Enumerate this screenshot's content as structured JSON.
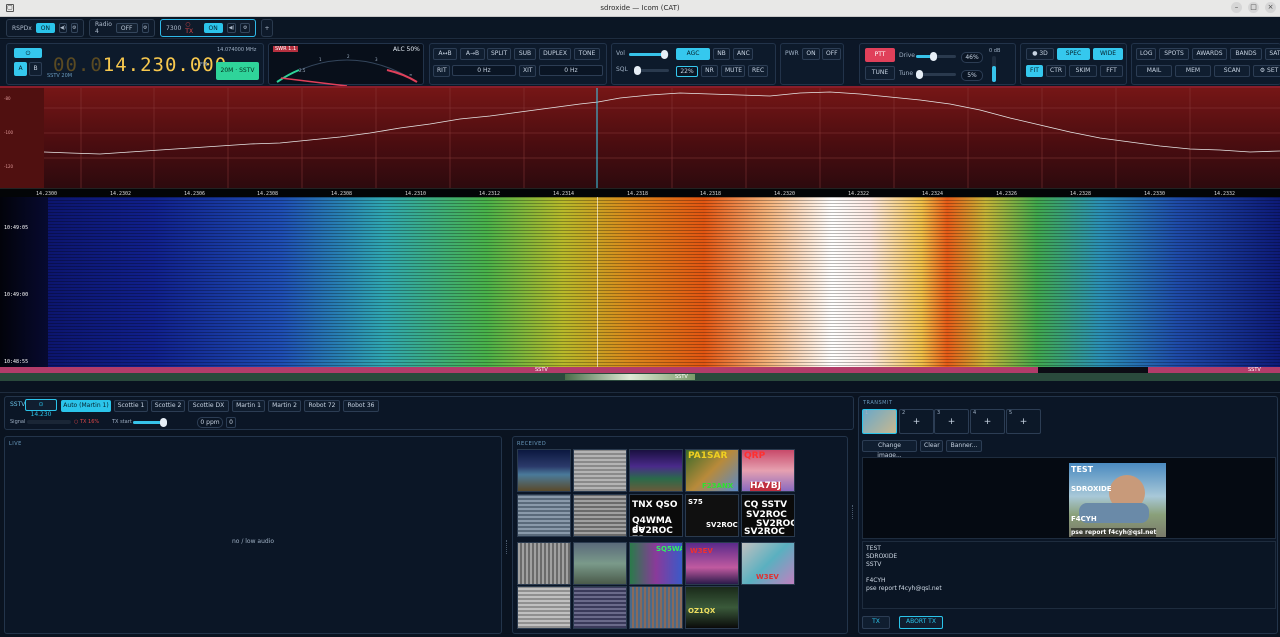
{
  "window": {
    "title": "sdroxide — Icom (CAT)"
  },
  "radio_tabs": [
    {
      "name": "RSPDx",
      "state": "ON"
    },
    {
      "name": "Radio 4",
      "state": "OFF"
    },
    {
      "name": "7300",
      "tx": "TX",
      "state": "ON"
    }
  ],
  "add_tab": "+",
  "vfo": {
    "power_icon": "power-icon",
    "a": "A",
    "b": "B",
    "freq_dim": "00.0",
    "freq_main": "14.230.000",
    "unit": "FM",
    "sub_freq": "14.074000 MHz",
    "mode_label": "SSTV 20M",
    "mode_button": "20M · SSTV"
  },
  "meter": {
    "swr": "SWR 1.1",
    "alc": "ALC 50%",
    "scale": [
      "1",
      "1.5",
      "2",
      "3",
      "∞"
    ],
    "low": "2.5"
  },
  "split_group": {
    "ab": "A↔B",
    "aeqb": "A→B",
    "split": "SPLIT",
    "sub": "SUB",
    "duplex": "DUPLEX",
    "tone": "TONE",
    "rit": "RIT",
    "rit_val": "0 Hz",
    "xit": "XIT",
    "xit_val": "0 Hz"
  },
  "audio_group": {
    "vol": "Vol",
    "sql": "SQL",
    "agc": "AGC Med",
    "nb": "NB",
    "anc": "ANC",
    "sql_val": "22%",
    "nr": "NR",
    "mute": "MUTE",
    "rec": "REC",
    "vol_level": 0.9,
    "sql_level": 0.1
  },
  "pwr_group": {
    "pwr": "PWR",
    "on": "ON",
    "off": "OFF"
  },
  "tx_group": {
    "ptt": "PTT",
    "tune": "TUNE",
    "drive": "Drive",
    "drive_val": "46%",
    "tune_lbl": "Tune",
    "tune_val": "5%",
    "db": "0 dB",
    "drive_level": 0.46,
    "tune_level": 0.05
  },
  "view_group": {
    "d3": "3D",
    "spec": "SPEC",
    "wide": "WIDE",
    "fit": "FIT",
    "ctr": "CTR",
    "skim": "SKIM",
    "fft": "FFT"
  },
  "tools_group": {
    "log": "LOG",
    "spots": "SPOTS",
    "awards": "AWARDS",
    "bands": "BANDS",
    "sat": "SAT",
    "mail": "MAIL",
    "mem": "MEM",
    "scan": "SCAN",
    "set": "SET"
  },
  "spectrum": {
    "db_labels": [
      "-80",
      "-100",
      "-120"
    ],
    "freq_labels": [
      "14.2300",
      "14.2302",
      "14.2306",
      "14.2308",
      "14.2308",
      "14.2310",
      "14.2312",
      "14.2314",
      "14.2318",
      "14.2318",
      "14.2320",
      "14.2322",
      "14.2324",
      "14.2326",
      "14.2328",
      "14.2330",
      "14.2332"
    ],
    "timestamps": [
      "10:49:05",
      "10:49:00",
      "10:48:55"
    ],
    "sstv_tag_left": "SSTV",
    "sstv_tag_right": "SSTV",
    "sstv_tag_mid": "SSTV"
  },
  "sstv": {
    "label": "SSTV",
    "freq_badge": "14.230",
    "modes": [
      "Auto (Martin 1)",
      "Scottie 1",
      "Scottie 2",
      "Scottie DX",
      "Martin 1",
      "Martin 2",
      "Robot 72",
      "Robot 36"
    ],
    "signal": "Signal",
    "tx_status": "TX 16%",
    "tx_start": "TX start",
    "ppm": "0 ppm",
    "ppm_btn": "0",
    "live": "LIVE",
    "no_audio": "no / low audio",
    "received": "RECEIVED",
    "transmit": "TRANSMIT",
    "slots": [
      "1",
      "2",
      "3",
      "4",
      "5"
    ],
    "slot_plus": "+",
    "change_image": "Change image...",
    "clear": "Clear",
    "banner": "Banner...",
    "tx_btn": "TX",
    "abort_btn": "ABORT TX",
    "tx_text": [
      "TEST",
      "SDROXIDE",
      "SSTV",
      "",
      "F4CYH",
      "pse report f4cyh@qsl.net"
    ],
    "preview_top": "TEST",
    "preview_mid": "SDROXIDE",
    "preview_call": "F4CYH",
    "preview_footer": "pse report f4cyh@qsl.net"
  },
  "thumbnails": {
    "t4": "PA1SAR",
    "t4b": "F23ANX",
    "t5": "QRP",
    "t5b": "HA7BJ",
    "t7a": "TNX QSO",
    "t7b": "Q4WMA de",
    "t7c": "SV2ROC 73",
    "t8a": "S75",
    "t8b": "SV2ROC",
    "t9a": "CQ SSTV",
    "t9b": "SV2ROC",
    "t9c": "SV2ROC",
    "t9d": "SV2ROC",
    "t13": "SQ5WA",
    "t14": "W3EV",
    "t15": "W3EV",
    "t19": "OZ1QX"
  },
  "colors": {
    "accent": "#2bc4ea",
    "freq": "#f7c84e",
    "alert": "#e0405a",
    "good": "#2fd49a"
  }
}
